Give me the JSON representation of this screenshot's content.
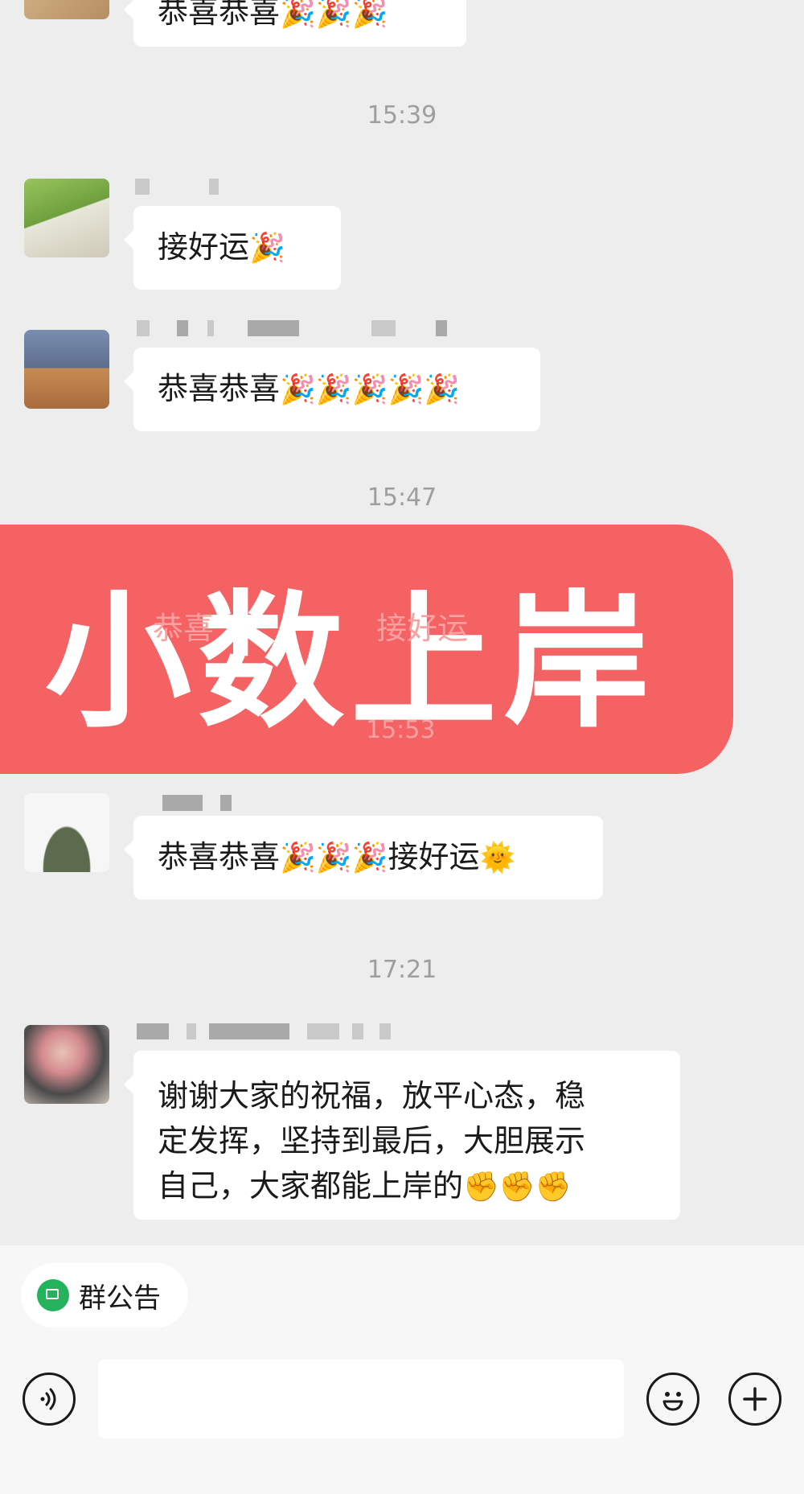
{
  "messages": [
    {
      "type": "partial",
      "text": "恭喜恭喜",
      "emoji": "🎉🎉🎉"
    },
    {
      "type": "time",
      "text": "15:39"
    },
    {
      "type": "msg",
      "text": "接好运",
      "emoji": "🎉"
    },
    {
      "type": "msg",
      "text": "恭喜恭喜",
      "emoji": "🎉🎉🎉🎉🎉"
    },
    {
      "type": "time",
      "text": "15:47"
    },
    {
      "type": "msg",
      "text": "恭喜恭喜",
      "emoji": "🎉🎉🎉",
      "text2": "接好运",
      "emoji2": "🌞"
    },
    {
      "type": "time",
      "text": "17:21"
    },
    {
      "type": "msg",
      "lines": [
        "谢谢大家的祝福，放平心态，稳",
        "定发挥，坚持到最后，大胆展示",
        "自己，大家都能上岸的"
      ],
      "emoji": "✊✊✊"
    }
  ],
  "overlay": {
    "text": "小数上岸",
    "ghost_text": "恭喜",
    "ghost_text2": "接好运",
    "ghost_time": "15:53"
  },
  "bottom_bar": {
    "notice_label": "群公告"
  },
  "colors": {
    "overlay": "#f46264",
    "background": "#ededed",
    "notice_icon": "#25b25c"
  }
}
